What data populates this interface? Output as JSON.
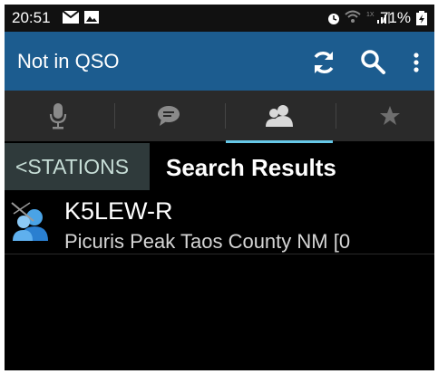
{
  "status_bar": {
    "time": "20:51",
    "battery": "71%"
  },
  "action_bar": {
    "title": "Not in QSO",
    "background": "#1c5c8f",
    "actions": [
      "refresh-icon",
      "search-icon",
      "overflow-menu-icon"
    ]
  },
  "tabs": [
    {
      "icon": "microphone-icon",
      "selected": false
    },
    {
      "icon": "chat-icon",
      "selected": false
    },
    {
      "icon": "stations-icon",
      "selected": true
    },
    {
      "icon": "star-icon",
      "selected": false
    }
  ],
  "breadcrumb": {
    "back_label": "<STATIONS",
    "title": "Search Results"
  },
  "results": [
    {
      "callsign": "K5LEW-R",
      "description": "Picuris Peak Taos County NM [0"
    }
  ],
  "colors": {
    "accent": "#66c8e8",
    "tab_bar": "#2a2a2a",
    "back_button": "#2f3a3b"
  }
}
